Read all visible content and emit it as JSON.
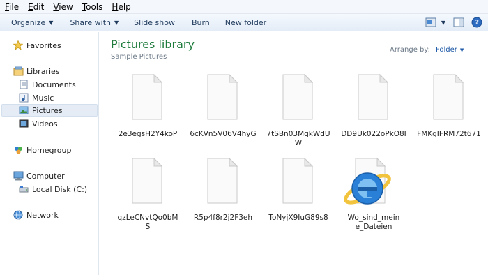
{
  "menubar": {
    "items": [
      {
        "acc": "F",
        "rest": "ile"
      },
      {
        "acc": "E",
        "rest": "dit"
      },
      {
        "acc": "V",
        "rest": "iew"
      },
      {
        "acc": "T",
        "rest": "ools"
      },
      {
        "acc": "H",
        "rest": "elp"
      }
    ]
  },
  "toolbar": {
    "organize": "Organize",
    "share_with": "Share with",
    "slide_show": "Slide show",
    "burn": "Burn",
    "new_folder": "New folder",
    "dropdown_arrow": "▼",
    "help_glyph": "?"
  },
  "nav": {
    "favorites": "Favorites",
    "libraries": "Libraries",
    "documents": "Documents",
    "music": "Music",
    "pictures": "Pictures",
    "videos": "Videos",
    "homegroup": "Homegroup",
    "computer": "Computer",
    "local_disk": "Local Disk (C:)",
    "network": "Network"
  },
  "content": {
    "title": "Pictures library",
    "subtitle": "Sample Pictures",
    "arrange_label": "Arrange by:",
    "arrange_value": "Folder",
    "ie_glyph": "e",
    "files": [
      {
        "name": "2e3egsH2Y4koP"
      },
      {
        "name": "6cKVn5V06V4hyG"
      },
      {
        "name": "7tSBn03MqkWdUW"
      },
      {
        "name": "DD9Uk022oPkO8I"
      },
      {
        "name": "FMKgIFRM72t671"
      },
      {
        "name": "qzLeCNvtQo0bMS"
      },
      {
        "name": "R5p4f8r2j2F3eh"
      },
      {
        "name": "ToNyjX9IuG89s8"
      },
      {
        "name": "Wo_sind_meine_Dateien"
      }
    ]
  }
}
